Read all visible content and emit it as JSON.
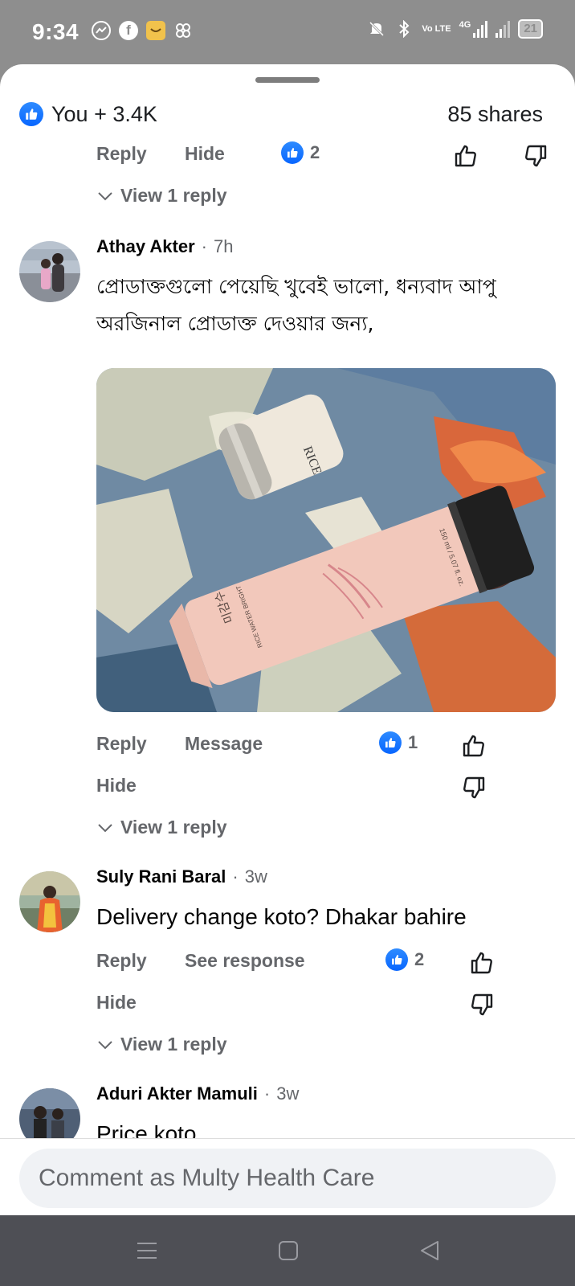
{
  "status_bar": {
    "time": "9:34",
    "left_icons": [
      "messenger-icon",
      "facebook-icon",
      "shop-bag-icon",
      "pinwheel-icon"
    ],
    "network_label": "Vo LTE",
    "network_type": "4G",
    "battery": "21"
  },
  "summary": {
    "reactions": "You + 3.4K",
    "shares": "85 shares"
  },
  "top_comment_actions": {
    "reply": "Reply",
    "hide": "Hide",
    "like_count": "2",
    "view_replies": "View 1 reply"
  },
  "comments": [
    {
      "author": "Athay Akter",
      "time": "7h",
      "text": "প্রোডাক্তগুলো পেয়েছি খুবেই ভালো, ধন্যবাদ আপু অরজিনাল প্রোডাক্ত দেওয়ার জন্য,",
      "photo_text": {
        "jar_label": "RICE",
        "tube_brand": "미감수",
        "tube_line": "RICE WATER BRIGHT",
        "tube_size": "150 ml / 5.07 fl. oz."
      },
      "actions": {
        "reply": "Reply",
        "message": "Message",
        "hide": "Hide"
      },
      "like_count": "1",
      "view_replies": "View 1 reply"
    },
    {
      "author": "Suly Rani Baral",
      "time": "3w",
      "text": "Delivery change koto? Dhakar bahire",
      "actions": {
        "reply": "Reply",
        "see_response": "See response",
        "hide": "Hide"
      },
      "like_count": "2",
      "view_replies": "View 1 reply"
    },
    {
      "author": "Aduri Akter Mamuli",
      "time": "3w",
      "text": "Price koto"
    }
  ],
  "composer": {
    "placeholder": "Comment as Multy Health Care"
  },
  "colors": {
    "like_blue": "#0866ff",
    "secondary_text": "#65676b",
    "status_bar": "#8e8e8e",
    "nav_bar": "#4e4f55"
  }
}
